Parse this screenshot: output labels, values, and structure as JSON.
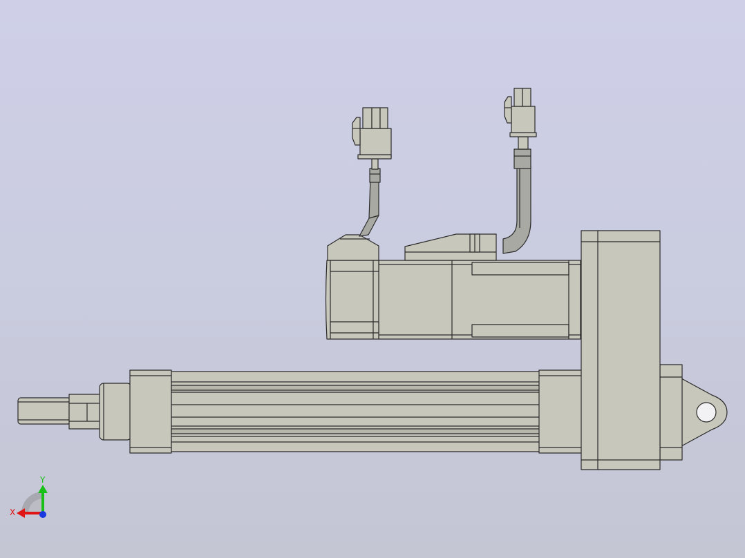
{
  "colors": {
    "background_top": "#cfd0e8",
    "background_bottom": "#c4c6d4",
    "part_fill": "#c8c7bc",
    "part_shade": "#b8b7ac",
    "edge": "#2a2a2a",
    "cable": "#a9a9a3",
    "axis_x": "#e01515",
    "axis_y": "#18c018",
    "axis_z": "#1a3ae0"
  },
  "icons": {
    "view_triad": "xyz-triad-icon"
  },
  "triad": {
    "x_label": "X",
    "y_label": "Y"
  }
}
